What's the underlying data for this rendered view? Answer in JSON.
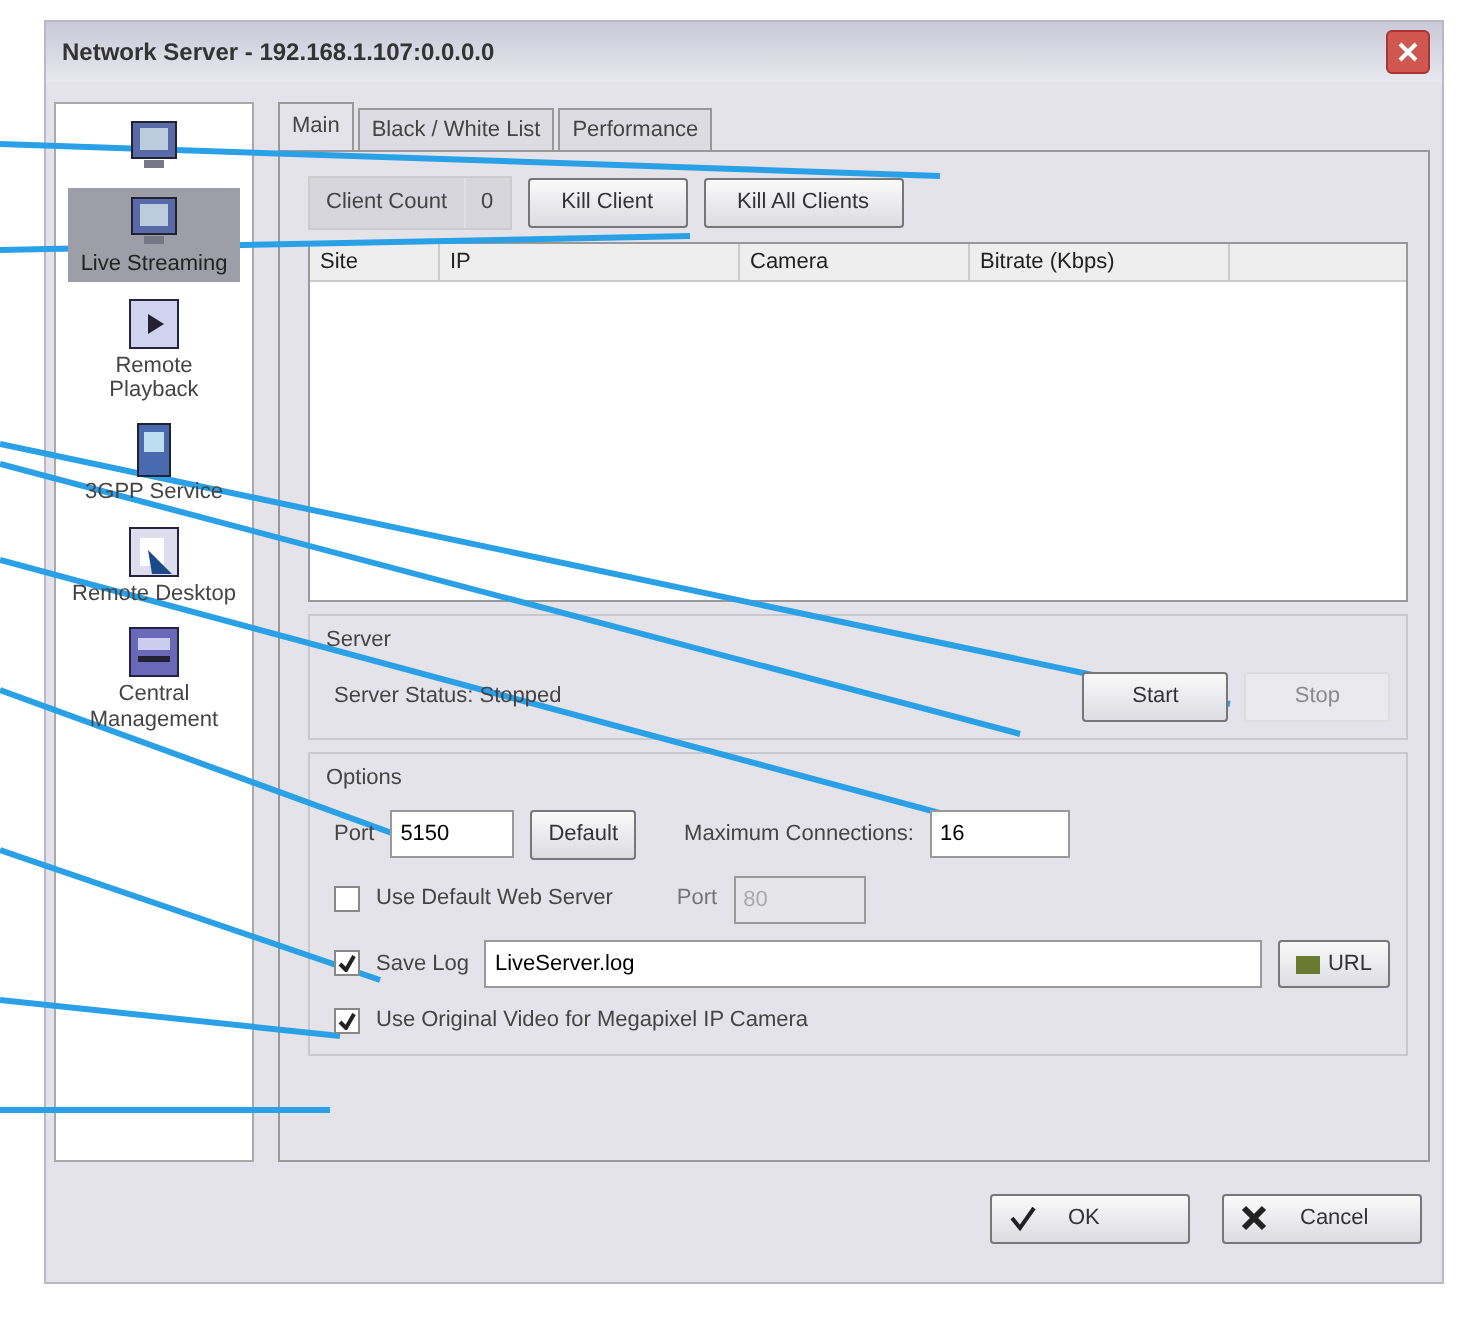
{
  "window": {
    "title": "Network Server - 192.168.1.107:0.0.0.0"
  },
  "sidebar": {
    "items": [
      {
        "selected": false,
        "kind": "monitor"
      },
      {
        "label": "Live Streaming",
        "selected": true,
        "kind": "monitor"
      },
      {
        "label": "Remote Playback",
        "selected": false,
        "kind": "play"
      },
      {
        "label": "3GPP Service",
        "selected": false,
        "kind": "phone"
      },
      {
        "label": "Remote Desktop",
        "selected": false,
        "kind": "desktop"
      },
      {
        "label": "Central Management",
        "selected": false,
        "kind": "server"
      }
    ]
  },
  "tabs": [
    {
      "label": "Main",
      "selected": true
    },
    {
      "label": "Black / White List",
      "selected": false
    },
    {
      "label": "Performance",
      "selected": false
    }
  ],
  "client_count": {
    "label": "Client Count",
    "value": "0"
  },
  "client_buttons": [
    "Kill Client",
    "Kill All Clients"
  ],
  "table": {
    "columns": [
      "Site",
      "IP",
      "Camera",
      "Bitrate (Kbps)"
    ]
  },
  "server": {
    "title": "Server",
    "status": "Server Status: Stopped",
    "buttons": [
      {
        "label": "Start",
        "disabled": false
      },
      {
        "label": "Stop",
        "disabled": true
      }
    ]
  },
  "options": {
    "title": "Options",
    "port_label": "Port",
    "port": "5150",
    "default_button": "Default",
    "max_label": "Maximum Connections:",
    "max": "16",
    "web_server": {
      "label": "Use Default Web Server",
      "checked": false,
      "port_label": "Port",
      "port": "80"
    },
    "save_log": {
      "label": "Save Log",
      "checked": true,
      "file": "LiveServer.log",
      "button": "URL"
    },
    "original_video": {
      "label": "Use Original Video for Megapixel IP Camera",
      "checked": true
    }
  },
  "buttons": [
    "OK",
    "Cancel"
  ]
}
